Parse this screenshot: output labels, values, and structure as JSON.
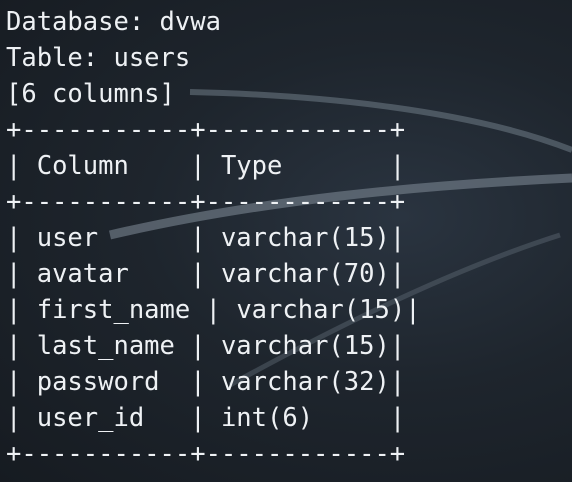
{
  "terminal": {
    "header_lines": [
      "Database: dvwa",
      "Table: users",
      "[6 columns]"
    ],
    "table": {
      "border": "+-----------+------------+",
      "columns": [
        "Column",
        "Type"
      ],
      "rows": [
        [
          "user",
          "varchar(15)"
        ],
        [
          "avatar",
          "varchar(70)"
        ],
        [
          "first_name",
          "varchar(15)"
        ],
        [
          "last_name",
          "varchar(15)"
        ],
        [
          "password",
          "varchar(32)"
        ],
        [
          "user_id",
          "int(6)"
        ]
      ]
    }
  },
  "colors": {
    "background": "#1b2128",
    "text": "#eef1f4"
  }
}
